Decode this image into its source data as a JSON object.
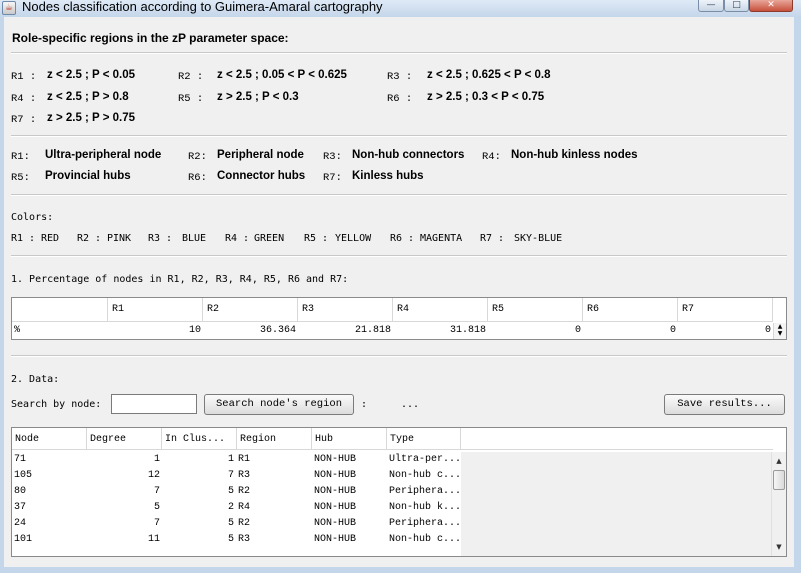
{
  "window": {
    "title": "Nodes classification according to Guimera-Amaral cartography",
    "icon": "java-cup-icon",
    "min_label": "—",
    "max_label": "□",
    "close_label": "✕"
  },
  "regions_section": {
    "title": "Role-specific regions in the zP parameter space:",
    "rows": [
      [
        {
          "label": "R1 :",
          "cond": "z < 2.5 ; P < 0.05"
        },
        {
          "label": "R2 :",
          "cond": "z < 2.5 ; 0.05 < P < 0.625"
        },
        {
          "label": "R3 :",
          "cond": "z < 2.5 ; 0.625 < P < 0.8"
        }
      ],
      [
        {
          "label": "R4 :",
          "cond": "z < 2.5 ; P > 0.8"
        },
        {
          "label": "R5 :",
          "cond": "z > 2.5 ; P < 0.3"
        },
        {
          "label": "R6 :",
          "cond": "z > 2.5 ; 0.3 < P < 0.75"
        }
      ],
      [
        {
          "label": "R7 :",
          "cond": "z > 2.5 ; P > 0.75"
        }
      ]
    ]
  },
  "roles_section": {
    "rows": [
      [
        {
          "label": "R1:",
          "name": "Ultra-peripheral node"
        },
        {
          "label": "R2:",
          "name": "Peripheral node"
        },
        {
          "label": "R3:",
          "name": "Non-hub connectors"
        },
        {
          "label": "R4:",
          "name": "Non-hub kinless nodes"
        }
      ],
      [
        {
          "label": "R5:",
          "name": "Provincial hubs"
        },
        {
          "label": "R6:",
          "name": "Connector hubs"
        },
        {
          "label": "R7:",
          "name": "Kinless hubs"
        }
      ]
    ]
  },
  "colors_section": {
    "title": "Colors:",
    "items": [
      {
        "label": "R1 :",
        "color": "RED"
      },
      {
        "label": "R2 :",
        "color": "PINK"
      },
      {
        "label": "R3 :",
        "color": "BLUE"
      },
      {
        "label": "R4 :",
        "color": "GREEN"
      },
      {
        "label": "R5 :",
        "color": "YELLOW"
      },
      {
        "label": "R6 :",
        "color": "MAGENTA"
      },
      {
        "label": "R7 :",
        "color": "SKY-BLUE"
      }
    ]
  },
  "percentage_section": {
    "title": "1. Percentage of nodes in R1, R2, R3, R4, R5, R6 and R7:",
    "headers": [
      "",
      "R1",
      "R2",
      "R3",
      "R4",
      "R5",
      "R6",
      "R7"
    ],
    "row": [
      "%",
      "10",
      "36.364",
      "21.818",
      "31.818",
      "0",
      "0",
      "0"
    ]
  },
  "data_section": {
    "title": "2. Data:",
    "search_label": "Search by node:",
    "search_value": "",
    "search_button": "Search node's region",
    "colon": ":",
    "result": "...",
    "save_button": "Save results...",
    "columns": [
      "Node",
      "Degree",
      "In Clus...",
      "Region",
      "Hub",
      "Type"
    ],
    "rows": [
      [
        "71",
        "1",
        "1",
        "R1",
        "NON-HUB",
        "Ultra-per..."
      ],
      [
        "105",
        "12",
        "7",
        "R3",
        "NON-HUB",
        "Non-hub c..."
      ],
      [
        "80",
        "7",
        "5",
        "R2",
        "NON-HUB",
        "Periphera..."
      ],
      [
        "37",
        "5",
        "2",
        "R4",
        "NON-HUB",
        "Non-hub k..."
      ],
      [
        "24",
        "7",
        "5",
        "R2",
        "NON-HUB",
        "Periphera..."
      ],
      [
        "101",
        "11",
        "5",
        "R3",
        "NON-HUB",
        "Non-hub c..."
      ]
    ]
  }
}
